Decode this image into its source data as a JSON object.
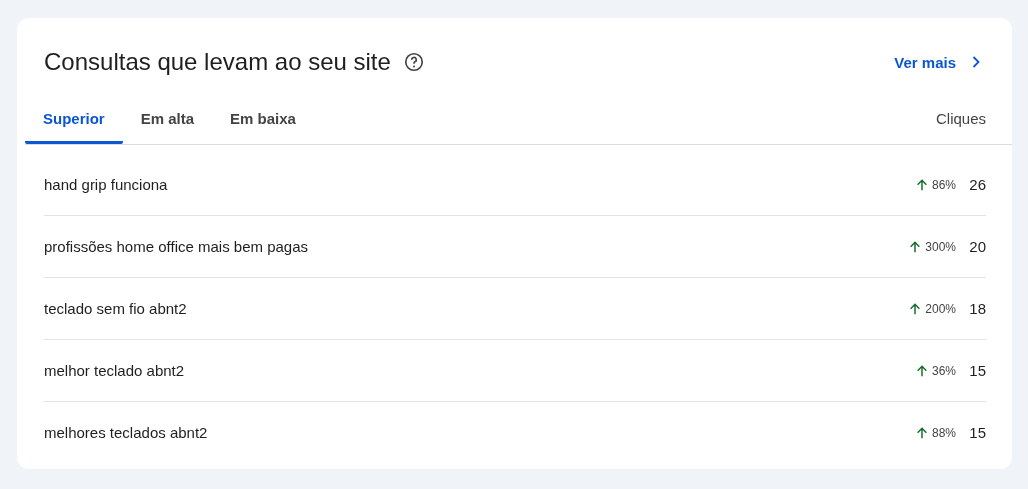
{
  "card": {
    "title": "Consultas que levam ao seu site",
    "more_link": "Ver mais",
    "tabs": [
      {
        "label": "Superior",
        "selected": true
      },
      {
        "label": "Em alta",
        "selected": false
      },
      {
        "label": "Em baixa",
        "selected": false
      }
    ],
    "column_header": "Cliques",
    "rows": [
      {
        "query": "hand grip funciona",
        "kind": "up",
        "change": "86%",
        "clicks": "26"
      },
      {
        "query": "profissões home office mais bem pagas",
        "kind": "up",
        "change": "300%",
        "clicks": "20"
      },
      {
        "query": "teclado sem fio abnt2",
        "kind": "up",
        "change": "200%",
        "clicks": "18"
      },
      {
        "query": "melhor teclado abnt2",
        "kind": "up",
        "change": "36%",
        "clicks": "15"
      },
      {
        "query": "melhores teclados abnt2",
        "kind": "up",
        "change": "88%",
        "clicks": "15"
      }
    ]
  }
}
